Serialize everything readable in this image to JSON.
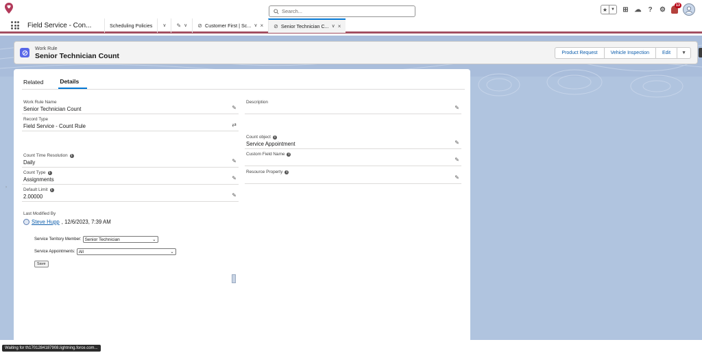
{
  "header": {
    "search_placeholder": "Search...",
    "notification_count": "13"
  },
  "nav": {
    "app_name": "Field Service - Con...",
    "tabs": [
      {
        "label": "Scheduling Policies"
      },
      {
        "label": "Customer First | Sc..."
      },
      {
        "label": "Senior Technician C..."
      }
    ]
  },
  "record": {
    "object_type": "Work Rule",
    "title": "Senior Technician Count",
    "actions": [
      "Product Request",
      "Vehicle Inspection",
      "Edit"
    ]
  },
  "detail_tabs": [
    "Related",
    "Details"
  ],
  "fields": {
    "work_rule_name": {
      "label": "Work Rule Name",
      "value": "Senior Technician Count"
    },
    "record_type": {
      "label": "Record Type",
      "value": "Field Service - Count Rule"
    },
    "description": {
      "label": "Description",
      "value": ""
    },
    "count_object": {
      "label": "Count object",
      "value": "Service Appointment"
    },
    "count_time_resolution": {
      "label": "Count Time Resolution",
      "value": "Daily"
    },
    "custom_field_name": {
      "label": "Custom Field Name",
      "value": ""
    },
    "count_type": {
      "label": "Count Type",
      "value": "Assignments"
    },
    "resource_property": {
      "label": "Resource Property",
      "value": ""
    },
    "default_limit": {
      "label": "Default Limit",
      "value": "2.00000"
    }
  },
  "last_modified": {
    "label": "Last Modified By",
    "user": "Steve Hupp",
    "date": ", 12/6/2023, 7:39 AM"
  },
  "vf": {
    "stm_label": "Service Territory Member:",
    "stm_value": "Senior Technician",
    "sa_label": "Service Appointments:",
    "sa_value": "All",
    "save_label": "Save"
  },
  "status": {
    "text": "Waiting for th1701284187908.lightning.force.com..."
  },
  "colors": {
    "brand_blue": "#0176d3",
    "page_background": "#b0c4df",
    "nav_accent": "#a24f61",
    "record_icon": "#5867e8"
  }
}
